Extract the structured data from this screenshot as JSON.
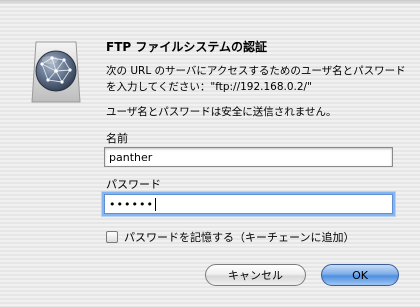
{
  "dialog": {
    "title": "FTP ファイルシステムの認証",
    "message": "次の URL のサーバにアクセスするためのユーザ名とパスワードを入力してください：\"ftp://192.168.0.2/\"",
    "warning": "ユーザ名とパスワードは安全に送信されません。",
    "icon": "network-globe-icon"
  },
  "form": {
    "name_label": "名前",
    "name_value": "panther",
    "password_label": "パスワード",
    "password_masked": "••••••",
    "remember_label": "パスワードを記憶する（キーチェーンに追加）",
    "remember_checked": false
  },
  "buttons": {
    "cancel": "キャンセル",
    "ok": "OK"
  },
  "colors": {
    "default_button": "#5b96e2",
    "focus_ring": "#86b4ee"
  }
}
